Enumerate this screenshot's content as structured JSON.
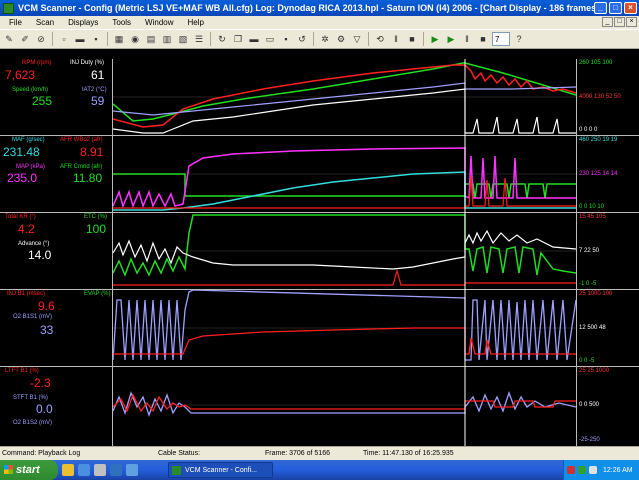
{
  "window": {
    "title": "VCM Scanner - Config (Metric LSJ VE+MAF WB All.cfg)  Log: Dynodag RICA 2013.hpl - Saturn ION (I4) 2006 - [Chart Display - 186 frames]",
    "min": "_",
    "max": "□",
    "close": "×"
  },
  "menu": {
    "items": [
      "File",
      "Scan",
      "Displays",
      "Tools",
      "Window",
      "Help"
    ]
  },
  "toolbar": {
    "frame_value": "7"
  },
  "panels": [
    {
      "labels": [
        {
          "name": "RPM (rpm)",
          "value": "7,623",
          "color": "#ff2020"
        },
        {
          "name": "INJ Duty (%)",
          "value": "61",
          "color": "#ffffff"
        },
        {
          "name": "Speed (km/h)",
          "value": "255",
          "color": "#22dd22"
        },
        {
          "name": "IAT2 (°C)",
          "value": "59",
          "color": "#a0a0ff"
        }
      ],
      "scale": [
        {
          "text": "260 105 100",
          "color": "#22dd22"
        },
        {
          "text": "4000 130 52 50",
          "color": "#ff3333"
        },
        {
          "text": "0  0   0   0",
          "color": "#ffffff"
        }
      ]
    },
    {
      "labels": [
        {
          "name": "MAF (g/sec)",
          "value": "231.48",
          "color": "#33dddd"
        },
        {
          "name": "AFR WBo2 (afr)",
          "value": "8.91",
          "color": "#ff2020"
        },
        {
          "name": "MAP (kPa)",
          "value": "235.0",
          "color": "#ff33ff"
        },
        {
          "name": "AFR Cmnd (afr)",
          "value": "11.80",
          "color": "#22dd22"
        }
      ],
      "scale": [
        {
          "text": "460 250 19 19",
          "color": "#33dddd"
        },
        {
          "text": "230 125 14 14",
          "color": "#ff33ff"
        },
        {
          "text": "0   0  10 10",
          "color": "#22dd22"
        }
      ]
    },
    {
      "labels": [
        {
          "name": "Total KR (°)",
          "value": "4.2",
          "color": "#ff2020"
        },
        {
          "name": "ETC (%)",
          "value": "100",
          "color": "#22dd22"
        },
        {
          "name": "Advance (°)",
          "value": "14.0",
          "color": "#ffffff"
        }
      ],
      "scale": [
        {
          "text": "15 45 105",
          "color": "#ff3333"
        },
        {
          "text": "7  22  50",
          "color": "#ffffff"
        },
        {
          "text": "-1  0  -5",
          "color": "#22dd22"
        }
      ]
    },
    {
      "labels": [
        {
          "name": "INJ B1 (msec)",
          "value": "9.6",
          "color": "#ff2020"
        },
        {
          "name": "EVAP (%)",
          "value": "",
          "color": "#22dd22"
        },
        {
          "name": "O2 B1S1 (mV)",
          "value": "33",
          "color": "#a0a0ff"
        }
      ],
      "scale": [
        {
          "text": "25 1000 100",
          "color": "#ff3333"
        },
        {
          "text": "12  500   48",
          "color": "#ffffff"
        },
        {
          "text": "0    0   -5",
          "color": "#22dd22"
        }
      ]
    },
    {
      "labels": [
        {
          "name": "LTFT B1 (%)",
          "value": "-2.3",
          "color": "#ff2020"
        },
        {
          "name": "STFT B1 (%)",
          "value": "0.0",
          "color": "#a0a0ff"
        },
        {
          "name": "O2 B1S2 (mV)",
          "value": "",
          "color": "#a0a0ff"
        }
      ],
      "scale": [
        {
          "text": "25 25 1000",
          "color": "#ff3333"
        },
        {
          "text": "0    0  500",
          "color": "#ffffff"
        },
        {
          "text": "-25-250",
          "color": "#a0a0ff"
        }
      ]
    }
  ],
  "status": {
    "command": "Command: Playback Log",
    "cable": "Cable Status:",
    "frame": "Frame: 3706 of 5166",
    "time": "Time: 11:47.130 of 16:25.935"
  },
  "taskbar": {
    "start": "start",
    "task": "VCM Scanner - Confi...",
    "clock": "12:26 AM"
  }
}
